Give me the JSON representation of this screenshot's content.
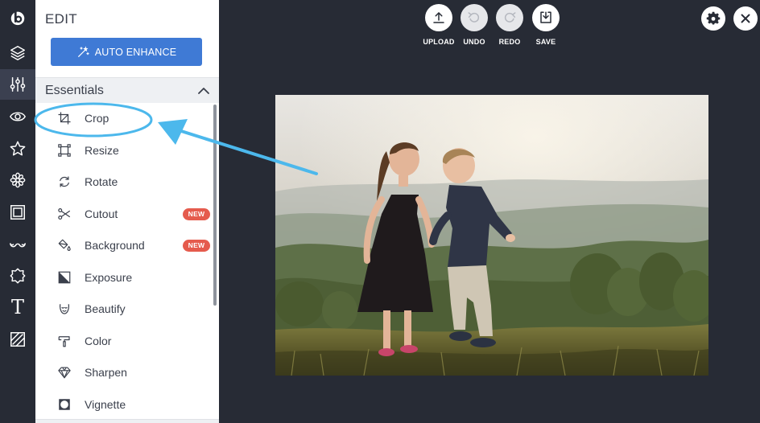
{
  "rail": {
    "items": [
      {
        "icon": "logo-icon"
      },
      {
        "icon": "layers-icon"
      },
      {
        "icon": "sliders-icon",
        "active": true
      },
      {
        "icon": "eye-icon"
      },
      {
        "icon": "star-icon"
      },
      {
        "icon": "flower-icon"
      },
      {
        "icon": "frame-icon"
      },
      {
        "icon": "mustache-icon"
      },
      {
        "icon": "shape-icon"
      },
      {
        "icon": "text-icon",
        "glyph": "T"
      },
      {
        "icon": "texture-icon"
      }
    ]
  },
  "panel": {
    "title": "EDIT",
    "auto_enhance_label": "AUTO ENHANCE",
    "section_title": "Essentials",
    "tools": [
      {
        "label": "Crop",
        "icon": "crop-icon"
      },
      {
        "label": "Resize",
        "icon": "resize-icon"
      },
      {
        "label": "Rotate",
        "icon": "rotate-icon"
      },
      {
        "label": "Cutout",
        "icon": "scissors-icon",
        "badge": "NEW"
      },
      {
        "label": "Background",
        "icon": "background-icon",
        "badge": "NEW"
      },
      {
        "label": "Exposure",
        "icon": "exposure-icon"
      },
      {
        "label": "Beautify",
        "icon": "beautify-icon"
      },
      {
        "label": "Color",
        "icon": "color-icon"
      },
      {
        "label": "Sharpen",
        "icon": "diamond-icon"
      },
      {
        "label": "Vignette",
        "icon": "vignette-icon"
      }
    ]
  },
  "toolbar": {
    "upload_label": "UPLOAD",
    "undo_label": "UNDO",
    "redo_label": "REDO",
    "save_label": "SAVE"
  },
  "colors": {
    "background": "#272b35",
    "accent": "#3f7ad5",
    "badge": "#e55b4d",
    "annotation": "#4cb8ec"
  }
}
